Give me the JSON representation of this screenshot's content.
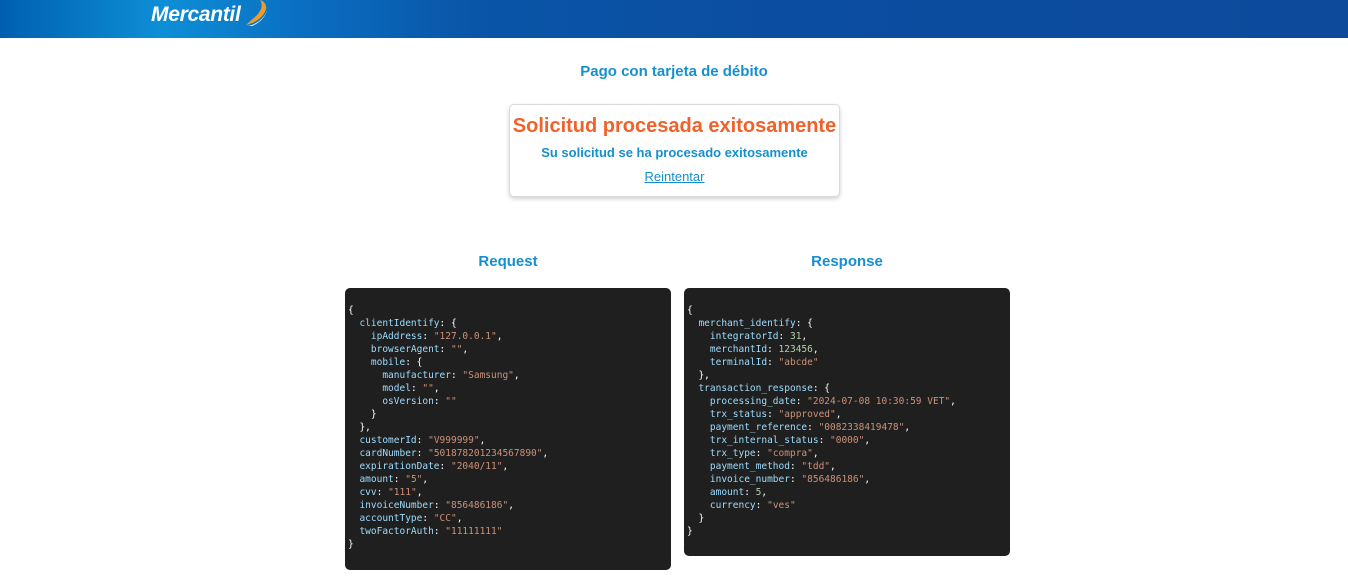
{
  "brand": {
    "name": "Mercantil"
  },
  "header": {
    "title": "Pago con tarjeta de débito"
  },
  "result": {
    "title": "Solicitud procesada exitosamente",
    "message": "Su solicitud se ha procesado exitosamente",
    "retry_label": "Reintentar"
  },
  "request": {
    "title": "Request",
    "lines": [
      [
        [
          "p",
          "{"
        ]
      ],
      [
        [
          "p",
          "  "
        ],
        [
          "k",
          "clientIdentify"
        ],
        [
          "p",
          ": {"
        ]
      ],
      [
        [
          "p",
          "    "
        ],
        [
          "k",
          "ipAddress"
        ],
        [
          "p",
          ": "
        ],
        [
          "s",
          "\"127.0.0.1\""
        ],
        [
          "p",
          ","
        ]
      ],
      [
        [
          "p",
          "    "
        ],
        [
          "k",
          "browserAgent"
        ],
        [
          "p",
          ": "
        ],
        [
          "s",
          "\"\""
        ],
        [
          "p",
          ","
        ]
      ],
      [
        [
          "p",
          "    "
        ],
        [
          "k",
          "mobile"
        ],
        [
          "p",
          ": {"
        ]
      ],
      [
        [
          "p",
          "      "
        ],
        [
          "k",
          "manufacturer"
        ],
        [
          "p",
          ": "
        ],
        [
          "s",
          "\"Samsung\""
        ],
        [
          "p",
          ","
        ]
      ],
      [
        [
          "p",
          "      "
        ],
        [
          "k",
          "model"
        ],
        [
          "p",
          ": "
        ],
        [
          "s",
          "\"\""
        ],
        [
          "p",
          ","
        ]
      ],
      [
        [
          "p",
          "      "
        ],
        [
          "k",
          "osVersion"
        ],
        [
          "p",
          ": "
        ],
        [
          "s",
          "\"\""
        ]
      ],
      [
        [
          "p",
          "    }"
        ]
      ],
      [
        [
          "p",
          "  },"
        ]
      ],
      [
        [
          "p",
          "  "
        ],
        [
          "k",
          "customerId"
        ],
        [
          "p",
          ": "
        ],
        [
          "s",
          "\"V999999\""
        ],
        [
          "p",
          ","
        ]
      ],
      [
        [
          "p",
          "  "
        ],
        [
          "k",
          "cardNumber"
        ],
        [
          "p",
          ": "
        ],
        [
          "s",
          "\"501878201234567890\""
        ],
        [
          "p",
          ","
        ]
      ],
      [
        [
          "p",
          "  "
        ],
        [
          "k",
          "expirationDate"
        ],
        [
          "p",
          ": "
        ],
        [
          "s",
          "\"2040/11\""
        ],
        [
          "p",
          ","
        ]
      ],
      [
        [
          "p",
          "  "
        ],
        [
          "k",
          "amount"
        ],
        [
          "p",
          ": "
        ],
        [
          "s",
          "\"5\""
        ],
        [
          "p",
          ","
        ]
      ],
      [
        [
          "p",
          "  "
        ],
        [
          "k",
          "cvv"
        ],
        [
          "p",
          ": "
        ],
        [
          "s",
          "\"111\""
        ],
        [
          "p",
          ","
        ]
      ],
      [
        [
          "p",
          "  "
        ],
        [
          "k",
          "invoiceNumber"
        ],
        [
          "p",
          ": "
        ],
        [
          "s",
          "\"856486186\""
        ],
        [
          "p",
          ","
        ]
      ],
      [
        [
          "p",
          "  "
        ],
        [
          "k",
          "accountType"
        ],
        [
          "p",
          ": "
        ],
        [
          "s",
          "\"CC\""
        ],
        [
          "p",
          ","
        ]
      ],
      [
        [
          "p",
          "  "
        ],
        [
          "k",
          "twoFactorAuth"
        ],
        [
          "p",
          ": "
        ],
        [
          "s",
          "\"11111111\""
        ]
      ],
      [
        [
          "p",
          "}"
        ]
      ]
    ]
  },
  "response": {
    "title": "Response",
    "lines": [
      [
        [
          "p",
          "{"
        ]
      ],
      [
        [
          "p",
          "  "
        ],
        [
          "k",
          "merchant_identify"
        ],
        [
          "p",
          ": {"
        ]
      ],
      [
        [
          "p",
          "    "
        ],
        [
          "k",
          "integratorId"
        ],
        [
          "p",
          ": "
        ],
        [
          "n",
          "31"
        ],
        [
          "p",
          ","
        ]
      ],
      [
        [
          "p",
          "    "
        ],
        [
          "k",
          "merchantId"
        ],
        [
          "p",
          ": "
        ],
        [
          "n",
          "123456"
        ],
        [
          "p",
          ","
        ]
      ],
      [
        [
          "p",
          "    "
        ],
        [
          "k",
          "terminalId"
        ],
        [
          "p",
          ": "
        ],
        [
          "s",
          "\"abcde\""
        ]
      ],
      [
        [
          "p",
          "  },"
        ]
      ],
      [
        [
          "p",
          "  "
        ],
        [
          "k",
          "transaction_response"
        ],
        [
          "p",
          ": {"
        ]
      ],
      [
        [
          "p",
          "    "
        ],
        [
          "k",
          "processing_date"
        ],
        [
          "p",
          ": "
        ],
        [
          "s",
          "\"2024-07-08 10:30:59 VET\""
        ],
        [
          "p",
          ","
        ]
      ],
      [
        [
          "p",
          "    "
        ],
        [
          "k",
          "trx_status"
        ],
        [
          "p",
          ": "
        ],
        [
          "s",
          "\"approved\""
        ],
        [
          "p",
          ","
        ]
      ],
      [
        [
          "p",
          "    "
        ],
        [
          "k",
          "payment_reference"
        ],
        [
          "p",
          ": "
        ],
        [
          "s",
          "\"0082338419478\""
        ],
        [
          "p",
          ","
        ]
      ],
      [
        [
          "p",
          "    "
        ],
        [
          "k",
          "trx_internal_status"
        ],
        [
          "p",
          ": "
        ],
        [
          "s",
          "\"0000\""
        ],
        [
          "p",
          ","
        ]
      ],
      [
        [
          "p",
          "    "
        ],
        [
          "k",
          "trx_type"
        ],
        [
          "p",
          ": "
        ],
        [
          "s",
          "\"compra\""
        ],
        [
          "p",
          ","
        ]
      ],
      [
        [
          "p",
          "    "
        ],
        [
          "k",
          "payment_method"
        ],
        [
          "p",
          ": "
        ],
        [
          "s",
          "\"tdd\""
        ],
        [
          "p",
          ","
        ]
      ],
      [
        [
          "p",
          "    "
        ],
        [
          "k",
          "invoice_number"
        ],
        [
          "p",
          ": "
        ],
        [
          "s",
          "\"856486186\""
        ],
        [
          "p",
          ","
        ]
      ],
      [
        [
          "p",
          "    "
        ],
        [
          "k",
          "amount"
        ],
        [
          "p",
          ": "
        ],
        [
          "n",
          "5"
        ],
        [
          "p",
          ","
        ]
      ],
      [
        [
          "p",
          "    "
        ],
        [
          "k",
          "currency"
        ],
        [
          "p",
          ": "
        ],
        [
          "s",
          "\"ves\""
        ]
      ],
      [
        [
          "p",
          "  }"
        ]
      ],
      [
        [
          "p",
          "}"
        ]
      ]
    ]
  }
}
